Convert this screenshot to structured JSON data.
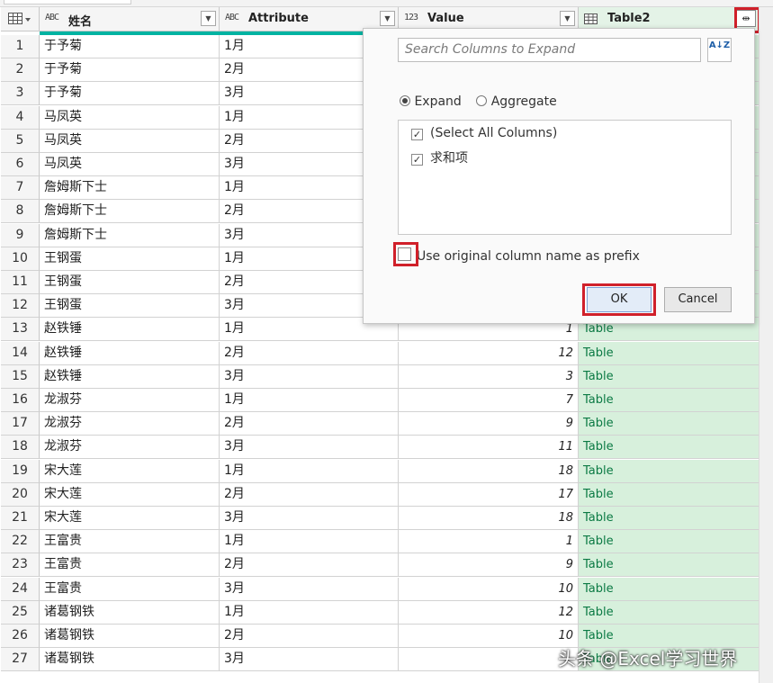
{
  "columns": {
    "name": {
      "label": "姓名",
      "type_icon": "ABC"
    },
    "attribute": {
      "label": "Attribute",
      "type_icon": "ABC"
    },
    "value": {
      "label": "Value",
      "type_icon": "123"
    },
    "table": {
      "label": "Table2",
      "type_icon": "table-icon"
    }
  },
  "rows": [
    {
      "n": "1",
      "name": "于予菊",
      "attr": "1月",
      "value": "",
      "table": ""
    },
    {
      "n": "2",
      "name": "于予菊",
      "attr": "2月",
      "value": "",
      "table": ""
    },
    {
      "n": "3",
      "name": "于予菊",
      "attr": "3月",
      "value": "",
      "table": ""
    },
    {
      "n": "4",
      "name": "马凤英",
      "attr": "1月",
      "value": "",
      "table": ""
    },
    {
      "n": "5",
      "name": "马凤英",
      "attr": "2月",
      "value": "",
      "table": ""
    },
    {
      "n": "6",
      "name": "马凤英",
      "attr": "3月",
      "value": "",
      "table": ""
    },
    {
      "n": "7",
      "name": "詹姆斯下士",
      "attr": "1月",
      "value": "",
      "table": ""
    },
    {
      "n": "8",
      "name": "詹姆斯下士",
      "attr": "2月",
      "value": "",
      "table": ""
    },
    {
      "n": "9",
      "name": "詹姆斯下士",
      "attr": "3月",
      "value": "",
      "table": ""
    },
    {
      "n": "10",
      "name": "王钢蛋",
      "attr": "1月",
      "value": "",
      "table": ""
    },
    {
      "n": "11",
      "name": "王钢蛋",
      "attr": "2月",
      "value": "",
      "table": ""
    },
    {
      "n": "12",
      "name": "王钢蛋",
      "attr": "3月",
      "value": "",
      "table": ""
    },
    {
      "n": "13",
      "name": "赵铁锤",
      "attr": "1月",
      "value": "1",
      "table": "Table"
    },
    {
      "n": "14",
      "name": "赵铁锤",
      "attr": "2月",
      "value": "12",
      "table": "Table"
    },
    {
      "n": "15",
      "name": "赵铁锤",
      "attr": "3月",
      "value": "3",
      "table": "Table"
    },
    {
      "n": "16",
      "name": "龙淑芬",
      "attr": "1月",
      "value": "7",
      "table": "Table"
    },
    {
      "n": "17",
      "name": "龙淑芬",
      "attr": "2月",
      "value": "9",
      "table": "Table"
    },
    {
      "n": "18",
      "name": "龙淑芬",
      "attr": "3月",
      "value": "11",
      "table": "Table"
    },
    {
      "n": "19",
      "name": "宋大莲",
      "attr": "1月",
      "value": "18",
      "table": "Table"
    },
    {
      "n": "20",
      "name": "宋大莲",
      "attr": "2月",
      "value": "17",
      "table": "Table"
    },
    {
      "n": "21",
      "name": "宋大莲",
      "attr": "3月",
      "value": "18",
      "table": "Table"
    },
    {
      "n": "22",
      "name": "王富贵",
      "attr": "1月",
      "value": "1",
      "table": "Table"
    },
    {
      "n": "23",
      "name": "王富贵",
      "attr": "2月",
      "value": "9",
      "table": "Table"
    },
    {
      "n": "24",
      "name": "王富贵",
      "attr": "3月",
      "value": "10",
      "table": "Table"
    },
    {
      "n": "25",
      "name": "诸葛钢铁",
      "attr": "1月",
      "value": "12",
      "table": "Table"
    },
    {
      "n": "26",
      "name": "诸葛钢铁",
      "attr": "2月",
      "value": "10",
      "table": "Table"
    },
    {
      "n": "27",
      "name": "诸葛钢铁",
      "attr": "3月",
      "value": "",
      "table": "Table"
    }
  ],
  "expand_popup": {
    "search_placeholder": "Search Columns to Expand",
    "sort_icon": "sort-az-icon",
    "sort_label": "A↓Z",
    "radio_expand": "Expand",
    "radio_aggregate": "Aggregate",
    "selected_mode": "Expand",
    "column_items": [
      {
        "label": "(Select All Columns)",
        "checked": true
      },
      {
        "label": "求和项",
        "checked": true
      }
    ],
    "prefix_label": "Use original column name as prefix",
    "prefix_checked": false,
    "ok_label": "OK",
    "cancel_label": "Cancel"
  },
  "watermark": "头条 @Excel学习世界",
  "colors": {
    "table_column_bg": "#d7f0dc",
    "table_text": "#0b7a44",
    "quality_bar": "#00b3a2",
    "highlight_box": "#d0202a"
  }
}
